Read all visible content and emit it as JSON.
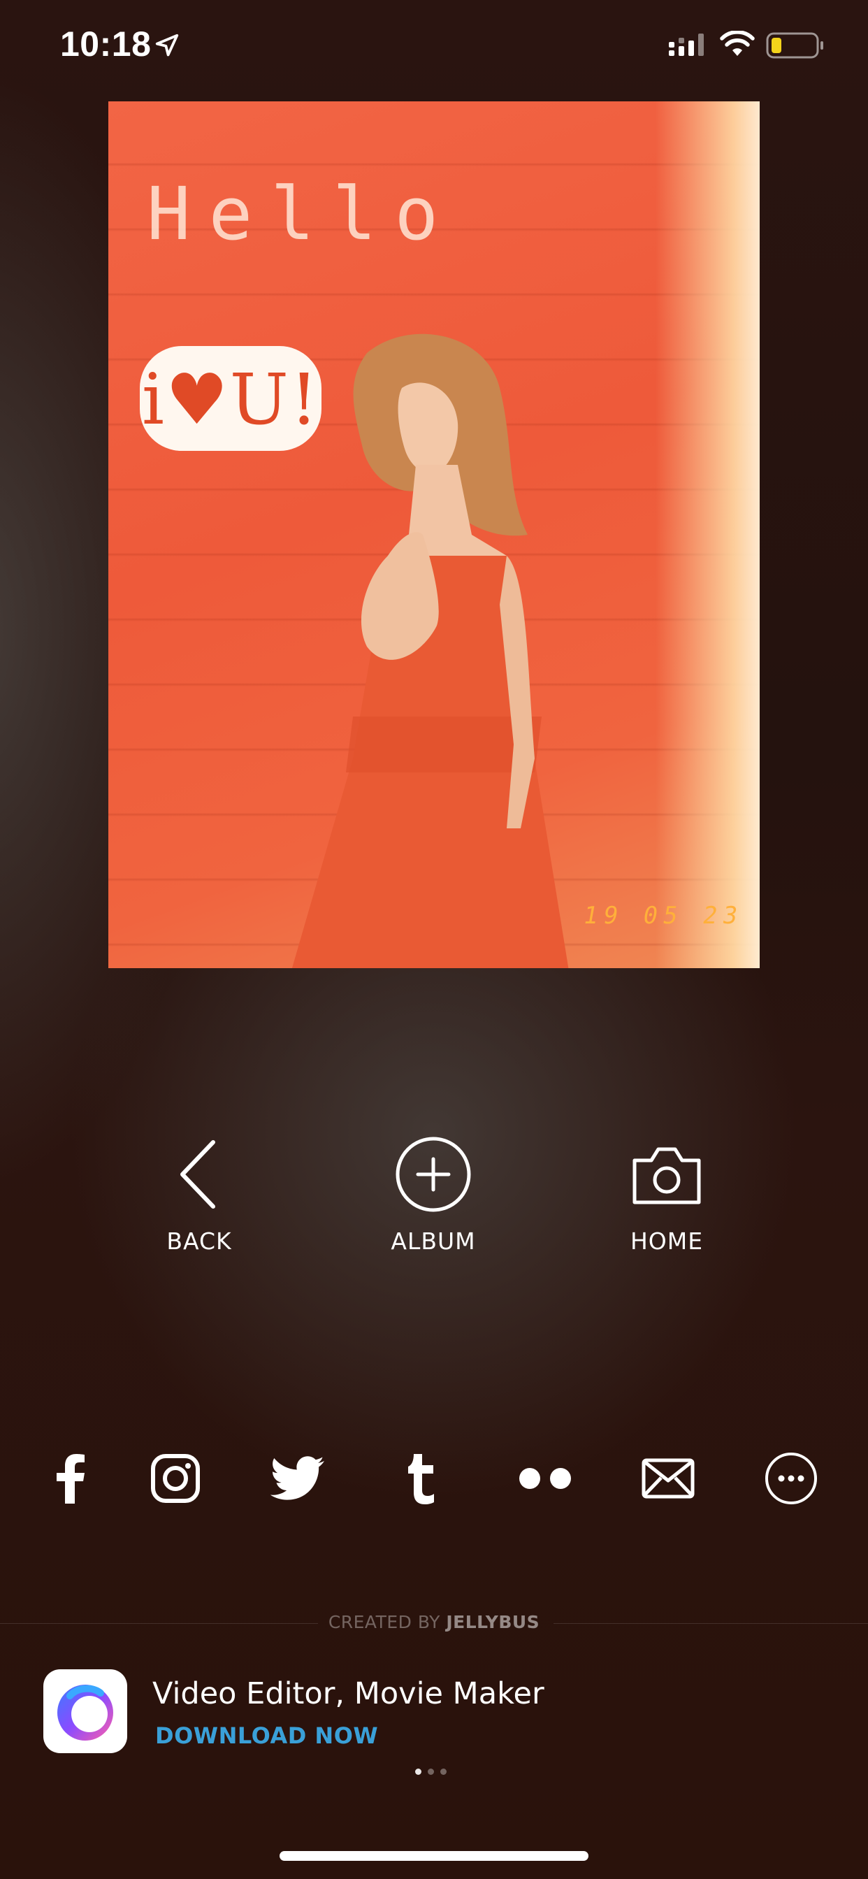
{
  "status_bar": {
    "time": "10:18",
    "icons": [
      "location-arrow-icon",
      "cellular-signal-icon",
      "wifi-icon",
      "battery-low-icon"
    ],
    "battery_color": "#f3d31b"
  },
  "photo": {
    "overlay_text": "Hello",
    "sticker_text": "i♥U!",
    "date_stamp": "19 05 23"
  },
  "actions": [
    {
      "label": "BACK",
      "icon": "chevron-left-icon"
    },
    {
      "label": "ALBUM",
      "icon": "plus-circle-icon"
    },
    {
      "label": "HOME",
      "icon": "camera-icon"
    }
  ],
  "share": [
    "facebook-icon",
    "instagram-icon",
    "twitter-icon",
    "tumblr-icon",
    "flickr-icon",
    "mail-icon",
    "more-icon"
  ],
  "footer": {
    "created_by_prefix": "CREATED BY",
    "created_by_brand": "JELLYBUS"
  },
  "ad": {
    "title": "Video Editor, Movie Maker",
    "cta": "DOWNLOAD NOW",
    "cta_color": "#3aa0d8",
    "pager_active_index": 0,
    "pager_count": 3
  }
}
